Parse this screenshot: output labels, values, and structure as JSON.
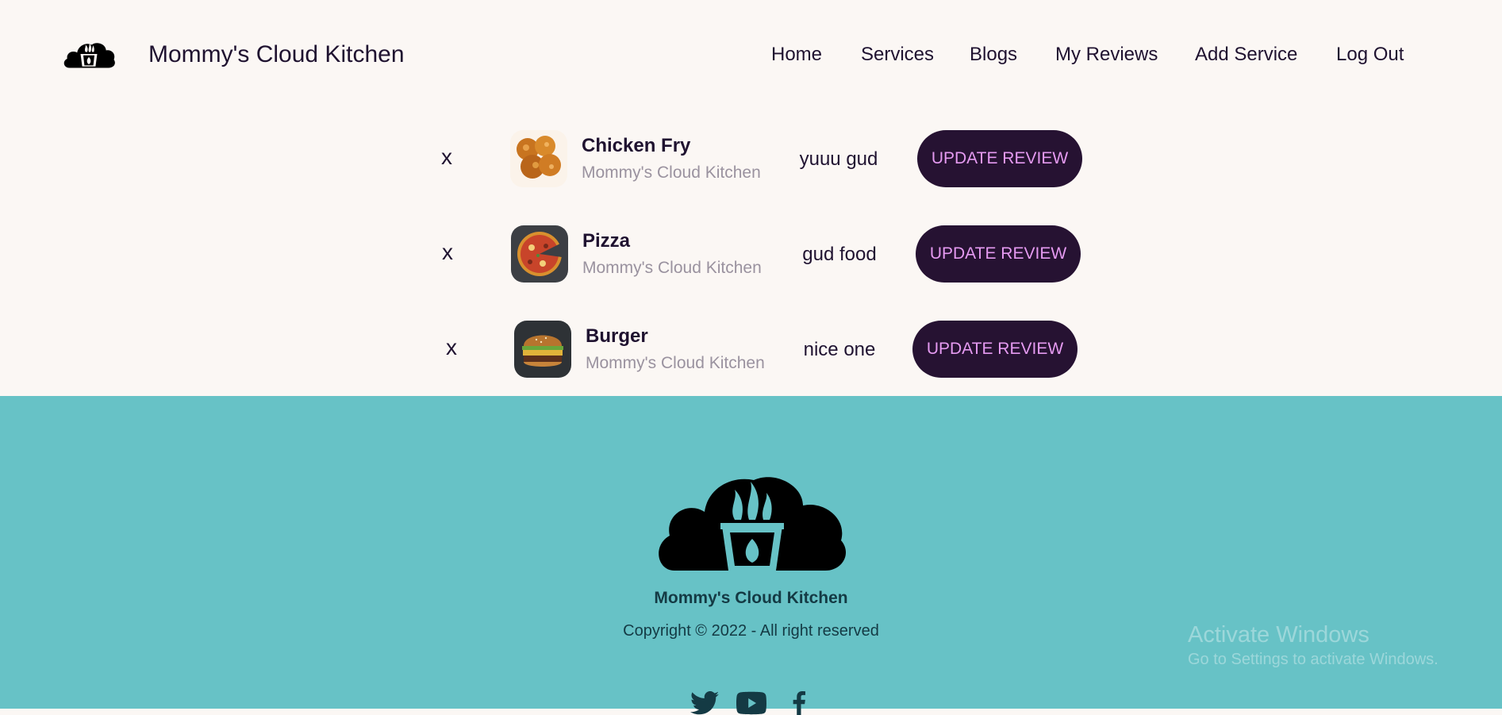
{
  "header": {
    "brand": "Mommy's Cloud Kitchen",
    "nav": [
      "Home",
      "Services",
      "Blogs",
      "My Reviews",
      "Add Service",
      "Log Out"
    ]
  },
  "reviews": [
    {
      "delete_label": "x",
      "name": "Chicken Fry",
      "kitchen": "Mommy's Cloud Kitchen",
      "text": "yuuu gud",
      "button": "UPDATE REVIEW"
    },
    {
      "delete_label": "x",
      "name": "Pizza",
      "kitchen": "Mommy's Cloud Kitchen",
      "text": "gud food",
      "button": "UPDATE REVIEW"
    },
    {
      "delete_label": "x",
      "name": "Burger",
      "kitchen": "Mommy's Cloud Kitchen",
      "text": "nice one",
      "button": "UPDATE REVIEW"
    }
  ],
  "footer": {
    "brand": "Mommy's Cloud Kitchen",
    "copyright": "Copyright © 2022 - All right reserved",
    "social_icons": [
      "twitter-icon",
      "youtube-icon",
      "facebook-icon"
    ]
  },
  "watermark": {
    "title": "Activate Windows",
    "subtitle": "Go to Settings to activate Windows."
  },
  "colors": {
    "page_bg": "#fbf7f4",
    "footer_bg": "#67c2c6",
    "button_bg": "#261232",
    "button_text": "#e59af1",
    "text_dark": "#1f1230",
    "text_muted": "#9a929f"
  }
}
